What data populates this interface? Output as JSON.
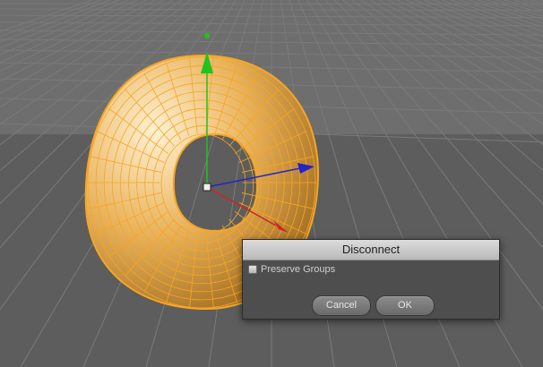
{
  "viewport": {
    "colors": {
      "background": "#5d5d5d",
      "horizon_band": "#6e6e6e",
      "grid_lines": "#7a7a7a",
      "torus_fill": "#e3aa56",
      "torus_wire": "#f6a623",
      "axis_y": "#1fc41f",
      "axis_x": "#d02424",
      "axis_z": "#2424c8"
    }
  },
  "dialog": {
    "title": "Disconnect",
    "preserve_groups_label": "Preserve Groups",
    "preserve_groups_checked": false,
    "cancel_label": "Cancel",
    "ok_label": "OK"
  }
}
